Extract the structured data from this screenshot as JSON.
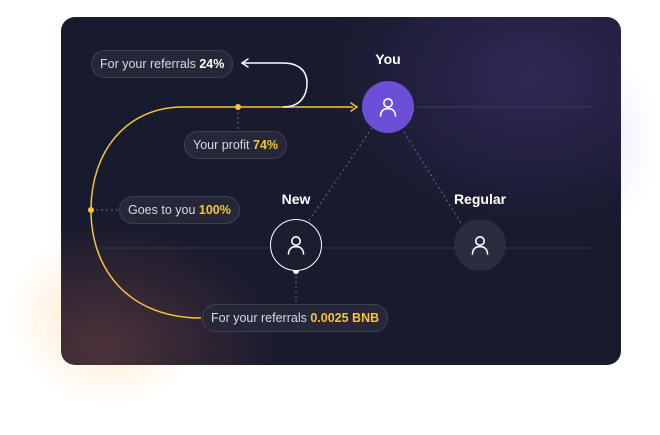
{
  "nodes": {
    "you": {
      "label": "You",
      "icon": "user-icon"
    },
    "new": {
      "label": "New",
      "icon": "user-icon"
    },
    "regular": {
      "label": "Regular",
      "icon": "user-icon"
    }
  },
  "pills": {
    "referrals_share": {
      "text": "For your referrals ",
      "value": "24%"
    },
    "your_profit": {
      "text": "Your profit ",
      "value": "74%"
    },
    "goes_to_you": {
      "text": "Goes to you ",
      "value": "100%"
    },
    "referrals_amount": {
      "text": "For your referrals ",
      "value": "0.0025 BNB"
    }
  },
  "colors": {
    "accent_yellow": "#f6c33a",
    "you_node": "#6b4fd9",
    "panel_bg": "#181a2d"
  }
}
